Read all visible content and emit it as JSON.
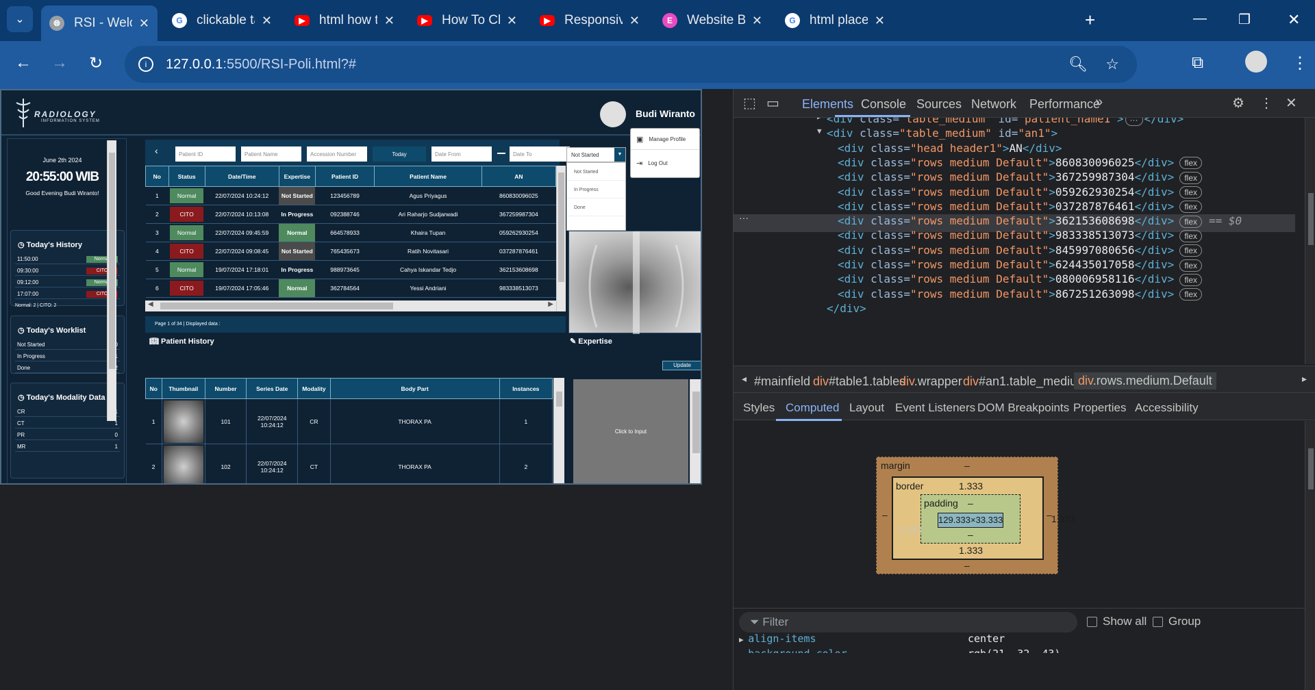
{
  "browser": {
    "tabs": [
      {
        "title": "RSI - Welcome",
        "favicon": "globe-icon",
        "active": true
      },
      {
        "title": "clickable table",
        "favicon": "google-icon"
      },
      {
        "title": "html how to cl",
        "favicon": "youtube-icon"
      },
      {
        "title": "How To Chang",
        "favicon": "youtube-icon"
      },
      {
        "title": "Responsive Na",
        "favicon": "youtube-icon"
      },
      {
        "title": "Website Builde",
        "favicon": "elementor-icon"
      },
      {
        "title": "html placehol",
        "favicon": "google-icon"
      }
    ],
    "url_host": "127.0.0.1",
    "url_rest": ":5500/RSI-Poli.html?#"
  },
  "app": {
    "logo_title": "RADIOLOGY",
    "logo_sub": "INFORMATION SYSTEM",
    "user_name": "Budi Wiranto",
    "user_menu": [
      "Manage Profile",
      "Log Out"
    ],
    "date": "June 2th 2024",
    "time": "20:55:00 WIB",
    "greeting": "Good Evening Budi Wiranto!",
    "history_title": "Today's History",
    "history": [
      {
        "time": "11:50:00",
        "status": "Normal"
      },
      {
        "time": "09:30:00",
        "status": "CITO"
      },
      {
        "time": "09:12:00",
        "status": "Normal"
      },
      {
        "time": "17:07:00",
        "status": "CITO"
      }
    ],
    "history_summary": "Normal: 2 | CITO: 2",
    "worklist_title": "Today's Worklist",
    "worklist": [
      {
        "label": "Not Started",
        "count": "0"
      },
      {
        "label": "In Progress",
        "count": "1"
      },
      {
        "label": "Done",
        "count": "2"
      }
    ],
    "modality_title": "Today's Modality Data",
    "modality": [
      {
        "label": "CR",
        "count": "1"
      },
      {
        "label": "CT",
        "count": "1"
      },
      {
        "label": "PR",
        "count": "0"
      },
      {
        "label": "MR",
        "count": "1"
      }
    ],
    "filters": {
      "patient_id": "Patient ID",
      "patient_name": "Patient Name",
      "accession": "Accession Number",
      "today": "Today",
      "date_from": "Date From",
      "date_to": "Date To",
      "status_selected": "Not Started",
      "status_options": [
        "Not Started",
        "In Progress",
        "Done"
      ]
    },
    "table_headers": [
      "No",
      "Status",
      "Date/Time",
      "Expertise",
      "Patient ID",
      "Patient Name",
      "AN"
    ],
    "table_rows": [
      [
        "1",
        "Normal",
        "22/07/2024 10:24:12",
        "Not Started",
        "123456789",
        "Agus Priyagus",
        "860830096025"
      ],
      [
        "2",
        "CITO",
        "22/07/2024 10:13:08",
        "In Progress",
        "092388746",
        "Ari Raharjo Sudjarwadi",
        "367259987304"
      ],
      [
        "3",
        "Normal",
        "22/07/2024 09:45:59",
        "Normal",
        "664578933",
        "Khaira Tupan",
        "059262930254"
      ],
      [
        "4",
        "CITO",
        "22/07/2024 09:08:45",
        "Not Started",
        "765435673",
        "Ratih Novitasari",
        "037287876461"
      ],
      [
        "5",
        "Normal",
        "19/07/2024 17:18:01",
        "In Progress",
        "988973645",
        "Cahya Iskandar Tedjo",
        "362153608698"
      ],
      [
        "6",
        "CITO",
        "19/07/2024 17:05:46",
        "Normal",
        "362784564",
        "Yessi Andriani",
        "983338513073"
      ]
    ],
    "pager": "Page 1 of 34 | Displayed data :",
    "patient_history_title": "Patient History",
    "expertise_title": "Expertise",
    "update_label": "Update",
    "click_to_input": "Click to Input",
    "history_headers": [
      "No",
      "Thumbnail",
      "Number",
      "Series Date",
      "Modality",
      "Body Part",
      "Instances"
    ],
    "history_rows": [
      [
        "1",
        "",
        "101",
        "22/07/2024 10:24:12",
        "CR",
        "THORAX PA",
        "1"
      ],
      [
        "2",
        "",
        "102",
        "22/07/2024 10:24:12",
        "CT",
        "THORAX PA",
        "2"
      ]
    ]
  },
  "devtools": {
    "tabs": [
      "Elements",
      "Console",
      "Sources",
      "Network",
      "Performance"
    ],
    "code": [
      {
        "indent": 1,
        "arrow": "▶",
        "text": "<div class=\"table_medium\" id=\"patient_name1\">",
        "tail": "</div>"
      },
      {
        "indent": 1,
        "arrow": "▼",
        "text": "<div class=\"table_medium\" id=\"an1\">"
      },
      {
        "indent": 2,
        "text": "<div class=\"head header1\">AN</div>"
      },
      {
        "indent": 2,
        "text": "<div class=\"rows medium Default\">860830096025</div>",
        "badge": "flex"
      },
      {
        "indent": 2,
        "text": "<div class=\"rows medium Default\">367259987304</div>",
        "badge": "flex"
      },
      {
        "indent": 2,
        "text": "<div class=\"rows medium Default\">059262930254</div>",
        "badge": "flex"
      },
      {
        "indent": 2,
        "text": "<div class=\"rows medium Default\">037287876461</div>",
        "badge": "flex"
      },
      {
        "indent": 2,
        "text": "<div class=\"rows medium Default\">362153608698</div>",
        "badge": "flex",
        "selected": true,
        "suffix": "== $0"
      },
      {
        "indent": 2,
        "text": "<div class=\"rows medium Default\">983338513073</div>",
        "badge": "flex"
      },
      {
        "indent": 2,
        "text": "<div class=\"rows medium Default\">845997080656</div>",
        "badge": "flex"
      },
      {
        "indent": 2,
        "text": "<div class=\"rows medium Default\">624435017058</div>",
        "badge": "flex"
      },
      {
        "indent": 2,
        "text": "<div class=\"rows medium Default\">080006958116</div>",
        "badge": "flex"
      },
      {
        "indent": 2,
        "text": "<div class=\"rows medium Default\">867251263098</div>",
        "badge": "flex"
      },
      {
        "indent": 1,
        "text": "</div>"
      }
    ],
    "breadcrumb": [
      "#mainfield",
      "div#table1.tables",
      "div.wrapper",
      "div#an1.table_medium",
      "div.rows.medium.Default"
    ],
    "subtabs": [
      "Styles",
      "Computed",
      "Layout",
      "Event Listeners",
      "DOM Breakpoints",
      "Properties",
      "Accessibility"
    ],
    "boxmodel": {
      "margin": "margin",
      "margin_val": "–",
      "border": "border",
      "border_val": "1.333",
      "padding": "padding",
      "padding_val": "–",
      "content": "129.333×33.333"
    },
    "filter_placeholder": "Filter",
    "show_all": "Show all",
    "group": "Group",
    "prop1": "align-items",
    "prop1_val": "center",
    "prop2": "background-color",
    "prop2_val": "rgb(21, 32, 43)"
  }
}
